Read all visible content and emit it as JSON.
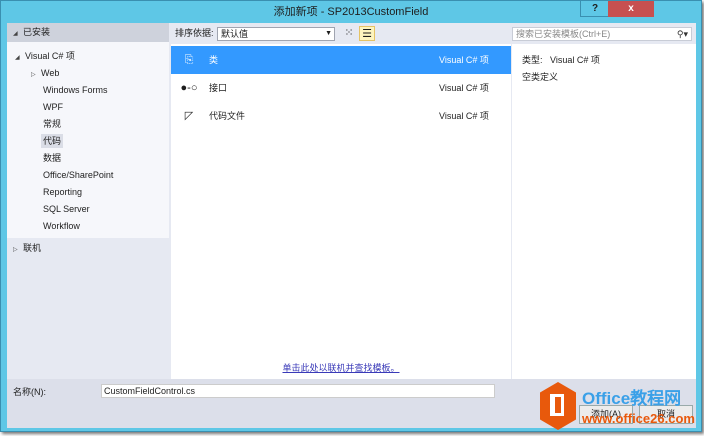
{
  "window": {
    "title": "添加新项 - SP2013CustomField",
    "help": "?",
    "close": "x"
  },
  "left": {
    "header": "已安装",
    "tree": [
      {
        "label": "Visual C# 项"
      },
      {
        "label": "Web"
      },
      {
        "label": "Windows Forms"
      },
      {
        "label": "WPF"
      },
      {
        "label": "常规"
      },
      {
        "label": "代码"
      },
      {
        "label": "数据"
      },
      {
        "label": "Office/SharePoint"
      },
      {
        "label": "Reporting"
      },
      {
        "label": "SQL Server"
      },
      {
        "label": "Workflow"
      }
    ],
    "online": "联机"
  },
  "toolbar": {
    "sort_label": "排序依据:",
    "sort_value": "默认值",
    "search_placeholder": "搜索已安装模板(Ctrl+E)"
  },
  "items": [
    {
      "name": "类",
      "lang": "Visual C# 项"
    },
    {
      "name": "接口",
      "lang": "Visual C# 项"
    },
    {
      "name": "代码文件",
      "lang": "Visual C# 项"
    }
  ],
  "online_link": "单击此处以联机并查找模板。",
  "details": {
    "type_label": "类型:",
    "type_value": "Visual C# 项",
    "description": "空类定义"
  },
  "bottom": {
    "name_label": "名称(N):",
    "name_value": "CustomFieldControl.cs",
    "add": "添加(A)",
    "cancel": "取消"
  },
  "watermark": {
    "brand": "Office教程网",
    "url": "www.office26.com"
  }
}
